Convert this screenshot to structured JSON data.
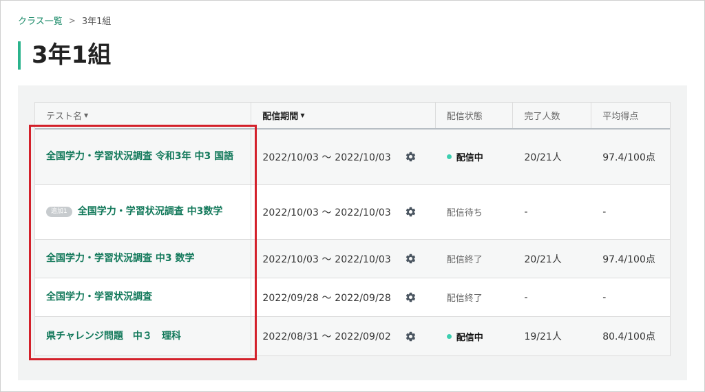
{
  "breadcrumb": {
    "parent": "クラス一覧",
    "separator": ">",
    "current": "3年1組"
  },
  "page_title": "3年1組",
  "table": {
    "headers": {
      "test_name": "テスト名",
      "period": "配信期間",
      "status": "配信状態",
      "completed": "完了人数",
      "average": "平均得点"
    },
    "rows": [
      {
        "badge": "",
        "name": "全国学力・学習状況調査 令和3年 中3 国語",
        "period": "2022/10/03 〜 2022/10/03",
        "status": "配信中",
        "status_live": true,
        "completed": "20/21人",
        "average": "97.4/100点"
      },
      {
        "badge": "追加1",
        "name": "全国学力・学習状況調査 中3数学",
        "period": "2022/10/03 〜 2022/10/03",
        "status": "配信待ち",
        "status_live": false,
        "completed": "-",
        "average": "-"
      },
      {
        "badge": "",
        "name": "全国学力・学習状況調査 中3 数学",
        "period": "2022/10/03 〜 2022/10/03",
        "status": "配信終了",
        "status_live": false,
        "completed": "20/21人",
        "average": "97.4/100点"
      },
      {
        "badge": "",
        "name": "全国学力・学習状況調査",
        "period": "2022/09/28 〜 2022/09/28",
        "status": "配信終了",
        "status_live": false,
        "completed": "-",
        "average": "-"
      },
      {
        "badge": "",
        "name": "県チャレンジ問題　中３　理科",
        "period": "2022/08/31 〜 2022/09/02",
        "status": "配信中",
        "status_live": true,
        "completed": "19/21人",
        "average": "80.4/100点"
      }
    ]
  },
  "colors": {
    "accent": "#2bb38c",
    "link": "#13795b",
    "live_dot": "#3ccfb0",
    "highlight": "#d3202a"
  }
}
